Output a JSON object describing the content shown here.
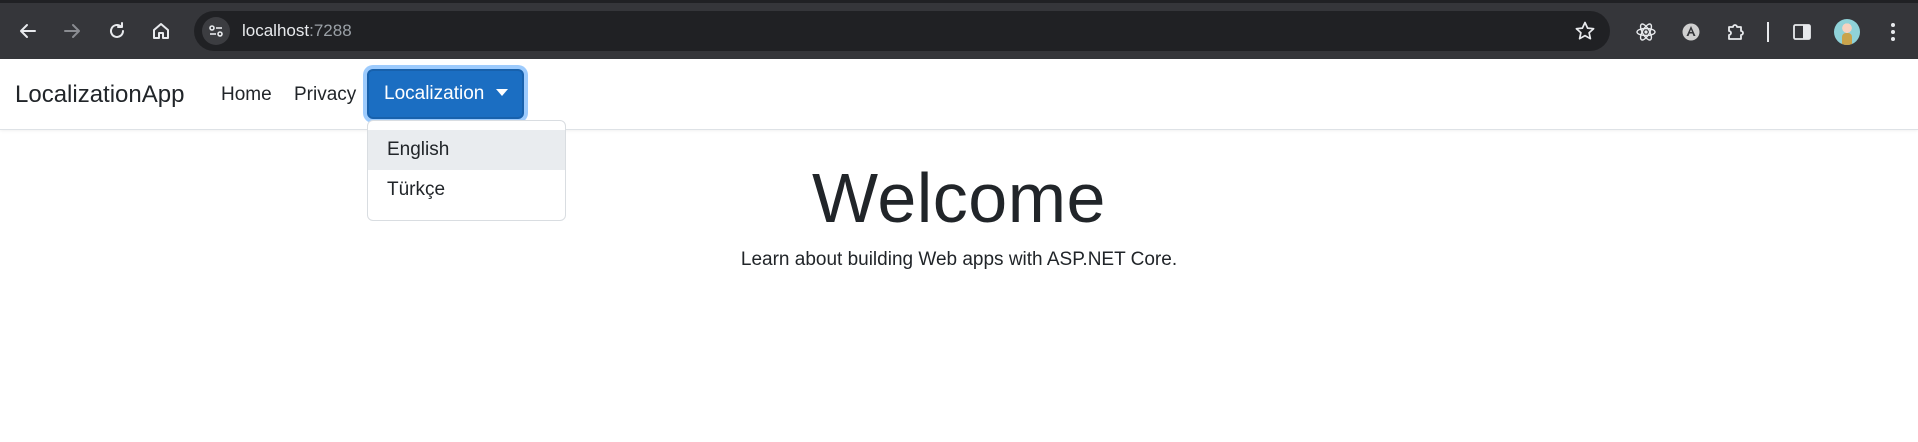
{
  "browser": {
    "url_host": "localhost",
    "url_port": ":7288",
    "icons": {
      "back": "arrow-left-icon",
      "forward": "arrow-right-icon",
      "reload": "reload-icon",
      "home": "home-icon",
      "site_info": "site-settings-icon",
      "bookmark": "star-icon",
      "extensions": [
        "react-devtools-icon",
        "angular-devtools-icon",
        "puzzle-extensions-icon"
      ],
      "side_panel": "side-panel-icon",
      "menu": "kebab-menu-icon"
    }
  },
  "navbar": {
    "brand": "LocalizationApp",
    "links": [
      "Home",
      "Privacy"
    ],
    "dropdown": {
      "label": "Localization",
      "items": [
        {
          "label": "English",
          "active": true
        },
        {
          "label": "Türkçe",
          "active": false
        }
      ]
    },
    "accent_color": "#1b6ec2"
  },
  "main": {
    "title": "Welcome",
    "lead": "Learn about building Web apps with ASP.NET Core."
  }
}
